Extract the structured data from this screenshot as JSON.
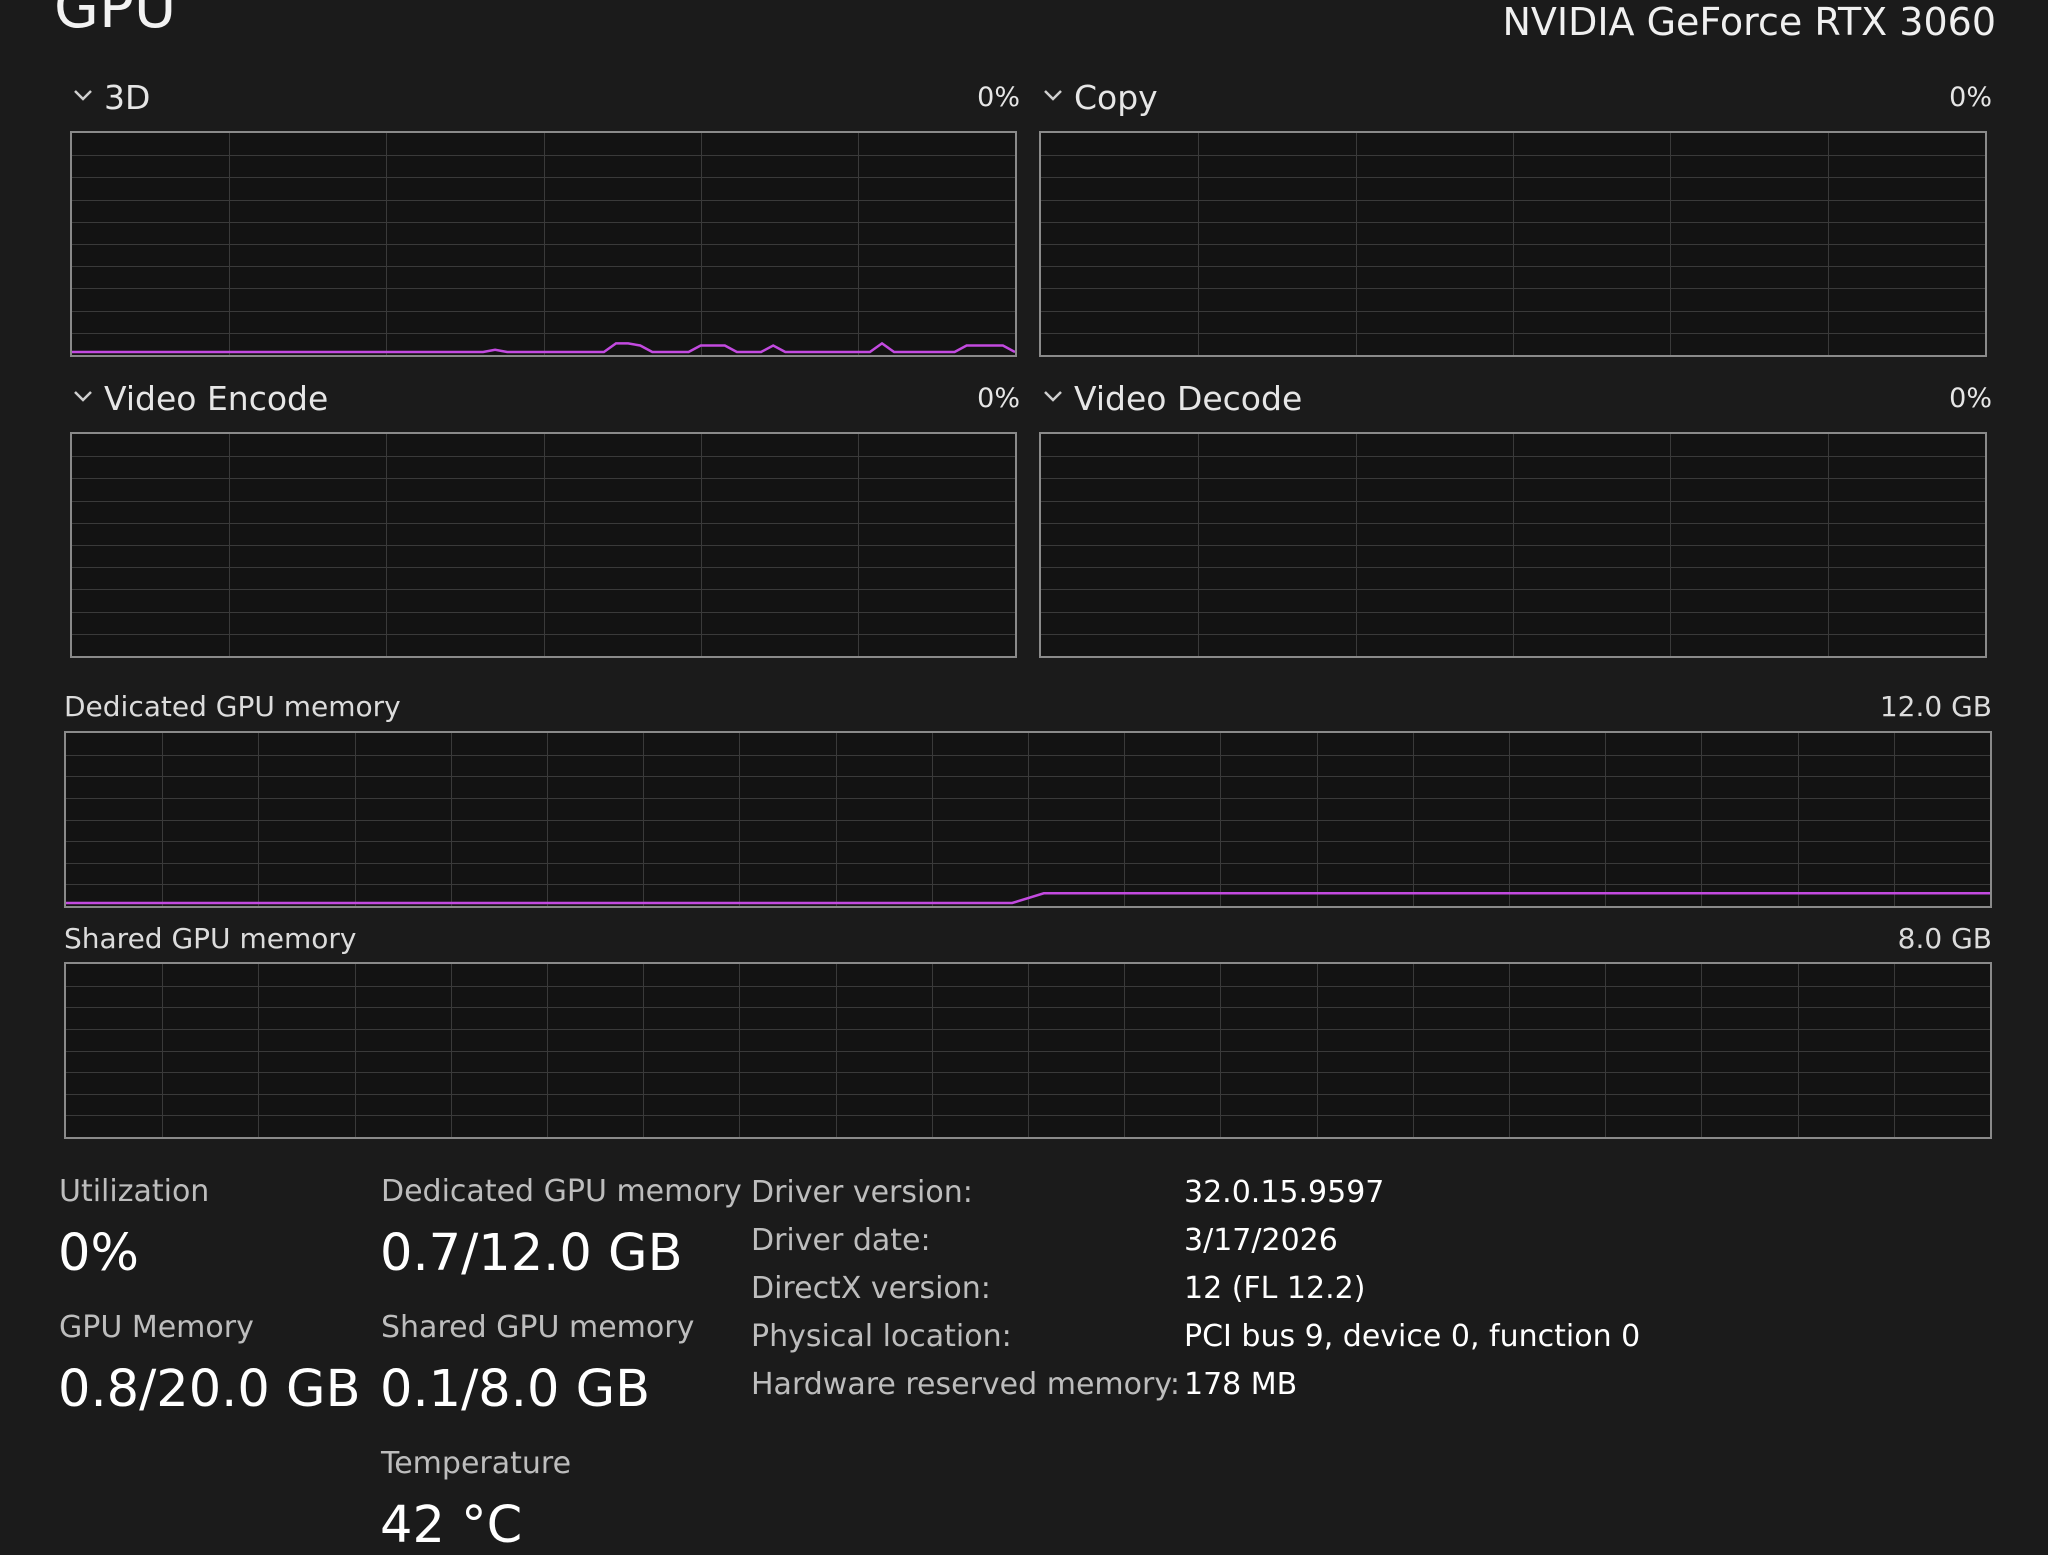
{
  "header": {
    "title": "GPU",
    "gpu_name": "NVIDIA GeForce RTX 3060"
  },
  "engines": [
    {
      "label": "3D",
      "percent": "0%",
      "usage_points": [
        0,
        0,
        0,
        0,
        0,
        0,
        0,
        0,
        0,
        0,
        0,
        0,
        0,
        0,
        0,
        0,
        0,
        0,
        0,
        0,
        0,
        0,
        0,
        0,
        0,
        0,
        0,
        0,
        0,
        0,
        0,
        0,
        0,
        0,
        0,
        1,
        0,
        0,
        0,
        0,
        0,
        0,
        0,
        0,
        0,
        4,
        4,
        3,
        0,
        0,
        0,
        0,
        3,
        3,
        3,
        0,
        0,
        0,
        3,
        0,
        0,
        0,
        0,
        0,
        0,
        0,
        0,
        4,
        0,
        0,
        0,
        0,
        0,
        0,
        3,
        3,
        3,
        3,
        0
      ]
    },
    {
      "label": "Copy",
      "percent": "0%",
      "usage_points": []
    },
    {
      "label": "Video Encode",
      "percent": "0%",
      "usage_points": []
    },
    {
      "label": "Video Decode",
      "percent": "0%",
      "usage_points": []
    }
  ],
  "dedicated_memory": {
    "label": "Dedicated GPU memory",
    "max": "12.0 GB",
    "history": [
      0,
      0,
      0,
      0,
      0,
      0,
      0,
      0,
      0,
      0,
      0,
      0,
      0,
      0,
      0,
      0,
      0,
      0,
      0,
      0,
      0,
      0,
      0,
      0,
      0,
      0,
      0,
      0,
      0,
      0,
      0,
      0.7,
      0.7,
      0.7,
      0.7,
      0.7,
      0.7,
      0.7,
      0.7,
      0.7,
      0.7,
      0.7,
      0.7,
      0.7,
      0.7,
      0.7,
      0.7,
      0.7,
      0.7,
      0.7,
      0.7,
      0.7,
      0.7,
      0.7,
      0.7,
      0.7,
      0.7,
      0.7,
      0.7,
      0.7,
      0.7,
      0.7
    ]
  },
  "shared_memory": {
    "label": "Shared GPU memory",
    "max": "8.0 GB",
    "history": []
  },
  "stats": {
    "utilization": {
      "label": "Utilization",
      "value": "0%"
    },
    "gpu_memory": {
      "label": "GPU Memory",
      "value": "0.8/20.0 GB"
    },
    "dedicated": {
      "label": "Dedicated GPU memory",
      "value": "0.7/12.0 GB"
    },
    "shared": {
      "label": "Shared GPU memory",
      "value": "0.1/8.0 GB"
    },
    "temperature": {
      "label": "Temperature",
      "value": "42 °C"
    }
  },
  "info": [
    {
      "label": "Driver version:",
      "value": "32.0.15.9597"
    },
    {
      "label": "Driver date:",
      "value": "3/17/2026"
    },
    {
      "label": "DirectX version:",
      "value": "12 (FL 12.2)"
    },
    {
      "label": "Physical location:",
      "value": "PCI bus 9, device 0, function 0"
    },
    {
      "label": "Hardware reserved memory:",
      "value": "178 MB"
    }
  ],
  "colors": {
    "background": "#1b1b1b",
    "graph_line": "#c34ae0",
    "grid": "#3a3a3a",
    "border": "#8a8a8a"
  }
}
